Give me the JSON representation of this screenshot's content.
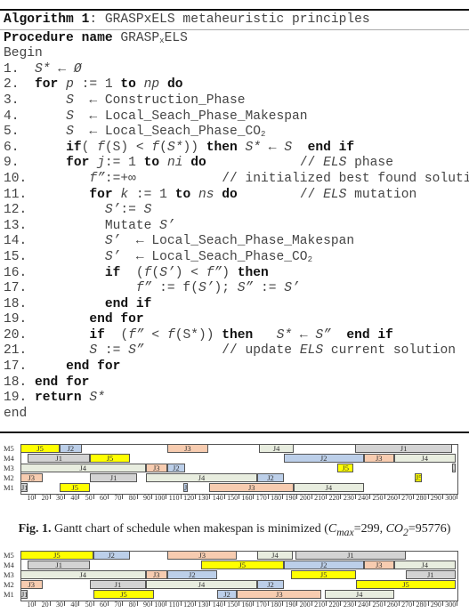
{
  "algorithm": {
    "lines": [
      [
        [
          "b",
          "Algorithm 1"
        ],
        [
          "n",
          ": GRASPxELS metaheuristic principles"
        ]
      ],
      [
        [
          "b",
          "Procedure name"
        ],
        [
          "n",
          " GRASP"
        ],
        [
          "sub",
          "x"
        ],
        [
          "n",
          "ELS"
        ]
      ],
      [
        [
          "n",
          "Begin"
        ]
      ],
      [
        [
          "n",
          "1.  "
        ],
        [
          "i",
          "S*"
        ],
        [
          "n",
          " ← "
        ],
        [
          "i",
          "Ø"
        ]
      ],
      [
        [
          "n",
          "2.  "
        ],
        [
          "b",
          "for"
        ],
        [
          "n",
          " "
        ],
        [
          "i",
          "p"
        ],
        [
          "n",
          " := 1 "
        ],
        [
          "b",
          "to"
        ],
        [
          "n",
          " "
        ],
        [
          "i",
          "np"
        ],
        [
          "n",
          " "
        ],
        [
          "b",
          "do"
        ]
      ],
      [
        [
          "n",
          "3.      "
        ],
        [
          "i",
          "S"
        ],
        [
          "n",
          "  ← Construction_Phase"
        ]
      ],
      [
        [
          "n",
          "4.      "
        ],
        [
          "i",
          "S"
        ],
        [
          "n",
          "  ← Local_Seach_Phase_Makespan"
        ]
      ],
      [
        [
          "n",
          "5.      "
        ],
        [
          "i",
          "S"
        ],
        [
          "n",
          "  ← Local_Seach_Phase_CO"
        ],
        [
          "sub",
          "2"
        ]
      ],
      [
        [
          "n",
          "6.      "
        ],
        [
          "b",
          "if"
        ],
        [
          "n",
          "( "
        ],
        [
          "i",
          "f"
        ],
        [
          "n",
          "(S) < "
        ],
        [
          "i",
          "f"
        ],
        [
          "n",
          "("
        ],
        [
          "i",
          "S*"
        ],
        [
          "n",
          ")) "
        ],
        [
          "b",
          "then"
        ],
        [
          "n",
          " "
        ],
        [
          "i",
          "S*"
        ],
        [
          "n",
          " ← "
        ],
        [
          "i",
          "S"
        ],
        [
          "n",
          "  "
        ],
        [
          "b",
          "end if"
        ]
      ],
      [
        [
          "n",
          "9.      "
        ],
        [
          "b",
          "for"
        ],
        [
          "n",
          " "
        ],
        [
          "i",
          "j"
        ],
        [
          "n",
          ":= 1 "
        ],
        [
          "b",
          "to"
        ],
        [
          "n",
          " "
        ],
        [
          "i",
          "ni"
        ],
        [
          "n",
          " "
        ],
        [
          "b",
          "do"
        ],
        [
          "n",
          "            // "
        ],
        [
          "i",
          "ELS"
        ],
        [
          "n",
          " phase"
        ]
      ],
      [
        [
          "n",
          "10.        "
        ],
        [
          "i",
          "f”"
        ],
        [
          "n",
          ":=+∞           // initialized best found solution"
        ]
      ],
      [
        [
          "n",
          "11.        "
        ],
        [
          "b",
          "for"
        ],
        [
          "n",
          " "
        ],
        [
          "i",
          "k"
        ],
        [
          "n",
          " := 1 "
        ],
        [
          "b",
          "to"
        ],
        [
          "n",
          " "
        ],
        [
          "i",
          "ns"
        ],
        [
          "n",
          " "
        ],
        [
          "b",
          "do"
        ],
        [
          "n",
          "        // "
        ],
        [
          "i",
          "ELS"
        ],
        [
          "n",
          " mutation"
        ]
      ],
      [
        [
          "n",
          "12.          "
        ],
        [
          "i",
          "S’"
        ],
        [
          "n",
          ":= "
        ],
        [
          "i",
          "S"
        ]
      ],
      [
        [
          "n",
          "13.          Mutate "
        ],
        [
          "i",
          "S’"
        ]
      ],
      [
        [
          "n",
          "14.          "
        ],
        [
          "i",
          "S’"
        ],
        [
          "n",
          "  ← Local_Seach_Phase_Makespan"
        ]
      ],
      [
        [
          "n",
          "15.          "
        ],
        [
          "i",
          "S’"
        ],
        [
          "n",
          "  ← Local_Seach_Phase_CO"
        ],
        [
          "sub",
          "2"
        ]
      ],
      [
        [
          "n",
          "16.          "
        ],
        [
          "b",
          "if"
        ],
        [
          "n",
          "  ("
        ],
        [
          "i",
          "f"
        ],
        [
          "n",
          "("
        ],
        [
          "i",
          "S’"
        ],
        [
          "n",
          ") < "
        ],
        [
          "i",
          "f”"
        ],
        [
          "n",
          ") "
        ],
        [
          "b",
          "then"
        ]
      ],
      [
        [
          "n",
          "17.              "
        ],
        [
          "i",
          "f”"
        ],
        [
          "n",
          " := f("
        ],
        [
          "i",
          "S’"
        ],
        [
          "n",
          "); "
        ],
        [
          "i",
          "S”"
        ],
        [
          "n",
          " := "
        ],
        [
          "i",
          "S’"
        ]
      ],
      [
        [
          "n",
          "18.          "
        ],
        [
          "b",
          "end if"
        ]
      ],
      [
        [
          "n",
          "19.        "
        ],
        [
          "b",
          "end for"
        ]
      ],
      [
        [
          "n",
          "20.        "
        ],
        [
          "b",
          "if"
        ],
        [
          "n",
          "  ("
        ],
        [
          "i",
          "f”"
        ],
        [
          "n",
          " < "
        ],
        [
          "i",
          "f"
        ],
        [
          "n",
          "(S*)) "
        ],
        [
          "b",
          "then"
        ],
        [
          "n",
          "   "
        ],
        [
          "i",
          "S*"
        ],
        [
          "n",
          " ← "
        ],
        [
          "i",
          "S”"
        ],
        [
          "n",
          "  "
        ],
        [
          "b",
          "end if"
        ]
      ],
      [
        [
          "n",
          "21.        "
        ],
        [
          "i",
          "S"
        ],
        [
          "n",
          " := "
        ],
        [
          "i",
          "S”"
        ],
        [
          "n",
          "          // update "
        ],
        [
          "i",
          "ELS"
        ],
        [
          "n",
          " current solution"
        ]
      ],
      [
        [
          "n",
          "17.     "
        ],
        [
          "b",
          "end for"
        ]
      ],
      [
        [
          "n",
          "18. "
        ],
        [
          "b",
          "end for"
        ]
      ],
      [
        [
          "n",
          "19. "
        ],
        [
          "b",
          "return"
        ],
        [
          "n",
          " "
        ],
        [
          "i",
          "S*"
        ]
      ],
      [
        [
          "n",
          "end"
        ]
      ]
    ]
  },
  "colors": {
    "J1": "#d3d3d3",
    "J2": "#bccfe9",
    "J3": "#f7ccb0",
    "J4": "#e8eddf",
    "J5": "#ffff00",
    "border": "#555555"
  },
  "chart_data": [
    {
      "type": "gantt",
      "machines": [
        "M5",
        "M4",
        "M3",
        "M2",
        "M1"
      ],
      "xticks": [
        10,
        20,
        30,
        40,
        50,
        60,
        70,
        80,
        90,
        100,
        110,
        120,
        130,
        140,
        150,
        160,
        170,
        180,
        190,
        200,
        210,
        220,
        230,
        240,
        250,
        260,
        270,
        280,
        290,
        300
      ],
      "xlim": [
        0,
        300
      ],
      "tasks": {
        "M5": [
          [
            "J5",
            0,
            27
          ],
          [
            "J2",
            27,
            42
          ],
          [
            "J3",
            101,
            129
          ],
          [
            "J4",
            164,
            188
          ],
          [
            "J1",
            230,
            297
          ]
        ],
        "M4": [
          [
            "J1",
            5,
            48
          ],
          [
            "J5",
            48,
            75
          ],
          [
            "J2",
            181,
            236
          ],
          [
            "J3",
            236,
            257
          ],
          [
            "J4",
            257,
            299
          ]
        ],
        "M3": [
          [
            "J4",
            0,
            86
          ],
          [
            "J3",
            86,
            101
          ],
          [
            "J2",
            101,
            113
          ],
          [
            "J5",
            218,
            229
          ],
          [
            "J1",
            297,
            299
          ]
        ],
        "M2": [
          [
            "J3",
            0,
            15
          ],
          [
            "J1",
            48,
            80
          ],
          [
            "J4",
            86,
            163
          ],
          [
            "J2",
            163,
            181
          ],
          [
            "J5",
            271,
            276
          ]
        ],
        "M1": [
          [
            "J1",
            0,
            5
          ],
          [
            "J5",
            27,
            48
          ],
          [
            "J2",
            112,
            115
          ],
          [
            "J3",
            130,
            188
          ],
          [
            "J4",
            188,
            236
          ]
        ]
      }
    },
    {
      "type": "gantt",
      "machines": [
        "M5",
        "M4",
        "M3",
        "M2",
        "M1"
      ],
      "xticks": [
        10,
        20,
        30,
        40,
        50,
        60,
        70,
        80,
        90,
        100,
        110,
        120,
        130,
        140,
        150,
        160,
        170,
        180,
        190,
        200,
        210,
        220,
        230,
        240,
        250,
        260,
        270,
        280,
        290,
        300
      ],
      "xlim": [
        0,
        300
      ],
      "tasks": {
        "M5": [
          [
            "J5",
            0,
            50
          ],
          [
            "J2",
            50,
            75
          ],
          [
            "J3",
            101,
            149
          ],
          [
            "J4",
            163,
            187
          ],
          [
            "J1",
            189,
            265
          ]
        ],
        "M4": [
          [
            "J1",
            5,
            48
          ],
          [
            "J5",
            124,
            181
          ],
          [
            "J2",
            181,
            236
          ],
          [
            "J3",
            236,
            257
          ],
          [
            "J4",
            257,
            299
          ]
        ],
        "M3": [
          [
            "J4",
            0,
            86
          ],
          [
            "J3",
            86,
            101
          ],
          [
            "J2",
            101,
            135
          ],
          [
            "J5",
            186,
            231
          ],
          [
            "J1",
            265,
            299
          ]
        ],
        "M2": [
          [
            "J3",
            0,
            15
          ],
          [
            "J1",
            48,
            86
          ],
          [
            "J4",
            86,
            163
          ],
          [
            "J2",
            163,
            181
          ],
          [
            "J5",
            231,
            299
          ]
        ],
        "M1": [
          [
            "J1",
            0,
            5
          ],
          [
            "J5",
            50,
            92
          ],
          [
            "J2",
            135,
            149
          ],
          [
            "J3",
            149,
            207
          ],
          [
            "J4",
            209,
            257
          ]
        ]
      }
    }
  ],
  "caption": {
    "prefix": "Fig. 1.",
    "text": " Gantt chart of schedule when makespan is minimized (",
    "cmax_label": "C",
    "cmax_sub": "max",
    "cmax_value": "=299, ",
    "co2_label": "CO",
    "co2_sub": "2",
    "co2_value": "=95776)"
  }
}
